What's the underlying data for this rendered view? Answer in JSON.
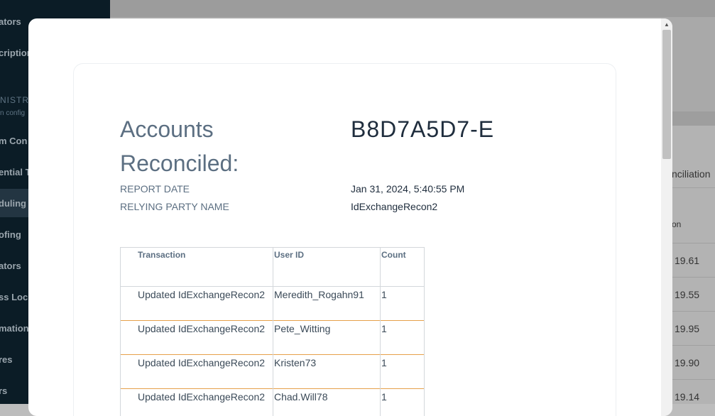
{
  "background": {
    "sidebar": {
      "items": [
        "ators",
        "cription",
        "m Con",
        "ential T",
        "duling",
        "ofing",
        "ators",
        "ss Loc",
        "mations",
        "res",
        "rs"
      ],
      "section_title": "NISTRA",
      "section_subtitle": "n config"
    },
    "table": {
      "header": "nciliation",
      "subheader": "on",
      "values": [
        "19.61",
        "19.55",
        "19.95",
        "19.90",
        "19.14"
      ]
    }
  },
  "report": {
    "title": "Accounts Reconciled:",
    "id": "B8D7A5D7-E",
    "report_date_label": "REPORT DATE",
    "report_date_value": "Jan 31, 2024, 5:40:55 PM",
    "relying_party_label": "RELYING PARTY NAME",
    "relying_party_value": "IdExchangeRecon2",
    "columns": [
      "Transaction",
      "User ID",
      "Count"
    ],
    "rows": [
      {
        "transaction": "Updated IdExchangeRecon2",
        "user_id": "Meredith_Rogahn91",
        "count": "1"
      },
      {
        "transaction": "Updated IdExchangeRecon2",
        "user_id": "Pete_Witting",
        "count": "1"
      },
      {
        "transaction": "Updated IdExchangeRecon2",
        "user_id": "Kristen73",
        "count": "1"
      },
      {
        "transaction": "Updated IdExchangeRecon2",
        "user_id": "Chad.Will78",
        "count": "1"
      }
    ]
  },
  "colors": {
    "row_accent": "#e6a04a",
    "sidebar_bg": "#0b1c26",
    "title_color": "#5c6f82"
  }
}
